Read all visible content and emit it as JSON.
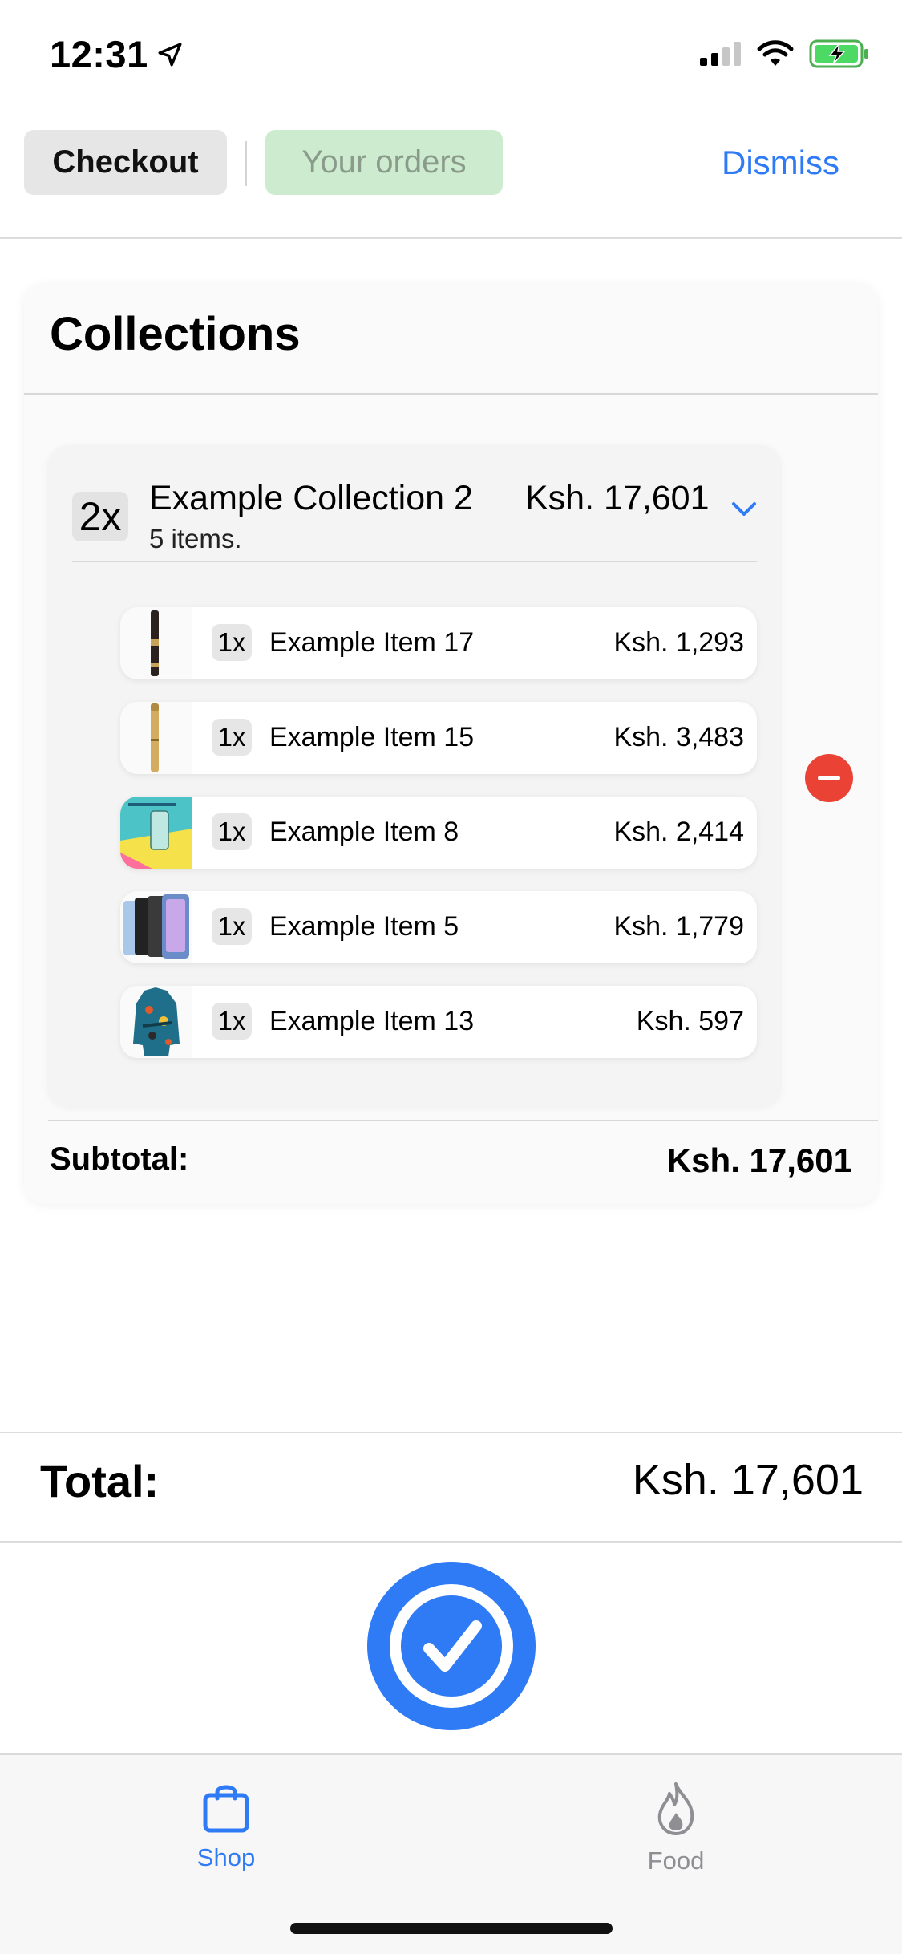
{
  "status_bar": {
    "time": "12:31"
  },
  "header": {
    "checkout_label": "Checkout",
    "orders_label": "Your orders",
    "dismiss_label": "Dismiss"
  },
  "collections": {
    "title": "Collections",
    "collection": {
      "quantity": "2x",
      "name": "Example Collection 2",
      "item_count": "5 items.",
      "price": "Ksh. 17,601",
      "items": [
        {
          "qty": "1x",
          "name": "Example Item 17",
          "price": "Ksh. 1,293"
        },
        {
          "qty": "1x",
          "name": "Example Item 15",
          "price": "Ksh. 3,483"
        },
        {
          "qty": "1x",
          "name": "Example Item 8",
          "price": "Ksh. 2,414"
        },
        {
          "qty": "1x",
          "name": "Example Item 5",
          "price": "Ksh. 1,779"
        },
        {
          "qty": "1x",
          "name": "Example Item 13",
          "price": "Ksh. 597"
        }
      ]
    },
    "subtotal_label": "Subtotal:",
    "subtotal_value": "Ksh. 17,601"
  },
  "total": {
    "label": "Total:",
    "value": "Ksh. 17,601"
  },
  "tab_bar": {
    "shop_label": "Shop",
    "food_label": "Food"
  },
  "colors": {
    "accent": "#2f7bf5",
    "remove": "#ea4335",
    "orders_bg": "#cdeccf",
    "inactive_tab": "#8e8e93"
  }
}
